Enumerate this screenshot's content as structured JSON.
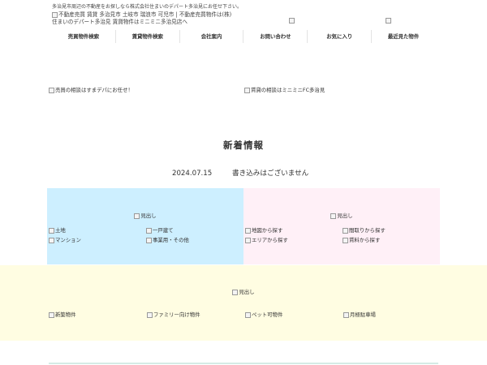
{
  "header": {
    "tagline": "多治見市周辺の不動産をお探しなら株式会社住まいのデパート多治見にお任せ下さい。",
    "logo_alt_line1": "不動産売買 賃貸 多治見市 土岐市 瑞浪市 可児市 | 不動産売買物件は(株)",
    "logo_alt_line2": "住まいのデパート多治見 賃貸物件はミニミニ多治見店へ"
  },
  "nav": {
    "items": [
      {
        "label": "売買物件検索"
      },
      {
        "label": "賃貸物件検索"
      },
      {
        "label": "会社案内"
      },
      {
        "label": "お問い合わせ"
      },
      {
        "label": "お気に入り"
      },
      {
        "label": "最近見た物件"
      }
    ]
  },
  "banners": {
    "sale": "売買の相談はすまデパにお任せ！",
    "rent": "賃貸の相談はミニミニFC多治見"
  },
  "news": {
    "title": "新着情報",
    "date": "2024.07.15",
    "message": "書き込みはございません"
  },
  "sale_panel": {
    "heading": "見出し",
    "items": [
      "土地",
      "一戸建て",
      "マンション",
      "事業用・その他"
    ]
  },
  "rent_panel": {
    "heading": "見出し",
    "items": [
      "地図から探す",
      "間取りから探す",
      "エリアから探す",
      "賃料から探す"
    ]
  },
  "feature_band": {
    "heading": "見出し",
    "items": [
      "新築物件",
      "ファミリー向け物件",
      "ペット可物件",
      "月極駐車場"
    ]
  },
  "colors": {
    "sale_bg": "#cdefff",
    "rent_bg": "#fff0f7",
    "band_bg": "#fffde2"
  }
}
